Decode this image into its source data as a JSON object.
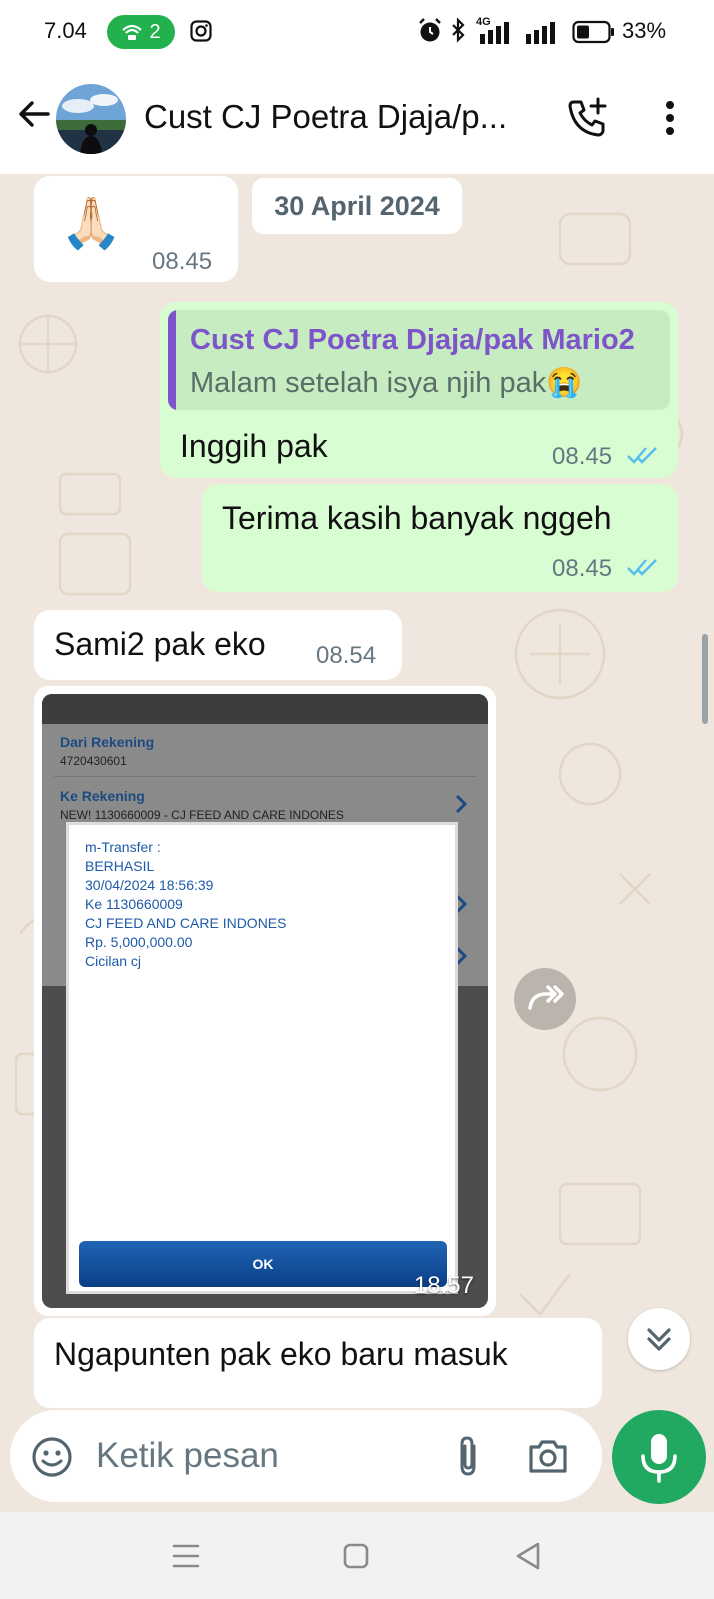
{
  "status_bar": {
    "time": "7.04",
    "hotspot_count": "2",
    "network": "4G",
    "battery": "33%"
  },
  "header": {
    "title": "Cust CJ Poetra Djaja/p..."
  },
  "chat": {
    "date_chip": "30 April 2024",
    "messages": [
      {
        "side": "in",
        "emoji": "🙏🏻",
        "time": "08.45"
      },
      {
        "side": "out",
        "quote": {
          "author": "Cust CJ Poetra Djaja/pak Mario2",
          "text": "Malam setelah isya njih pak😭"
        },
        "text": "Inggih pak",
        "time": "08.45"
      },
      {
        "side": "out",
        "text": "Terima kasih banyak nggeh",
        "time": "08.45"
      },
      {
        "side": "in",
        "text": "Sami2 pak eko",
        "time": "08.54"
      },
      {
        "side": "in",
        "type": "image",
        "time": "18.57",
        "image": {
          "row1_label": "Dari Rekening",
          "row1_value": "4720430601",
          "row2_label": "Ke Rekening",
          "row2_value": "NEW! 1130660009 - CJ FEED AND CARE INDONES",
          "dialog_lines": [
            "m-Transfer :",
            "BERHASIL",
            "30/04/2024 18:56:39",
            "Ke 1130660009",
            "CJ FEED AND CARE INDONES",
            "Rp. 5,000,000.00",
            "Cicilan cj"
          ],
          "ok_label": "OK"
        }
      },
      {
        "side": "in",
        "text": "Ngapunten pak eko baru masuk"
      }
    ]
  },
  "composer": {
    "placeholder": "Ketik pesan"
  },
  "colors": {
    "accent_green": "#21a961",
    "outgoing_bubble": "#d9fdd3",
    "quote_author": "#7d54c9",
    "read_ticks": "#53bdeb"
  },
  "icons": [
    "back-arrow-icon",
    "add-call-icon",
    "more-vert-icon",
    "forward-icon",
    "scroll-down-icon",
    "emoji-icon",
    "attach-icon",
    "camera-icon",
    "mic-icon"
  ]
}
